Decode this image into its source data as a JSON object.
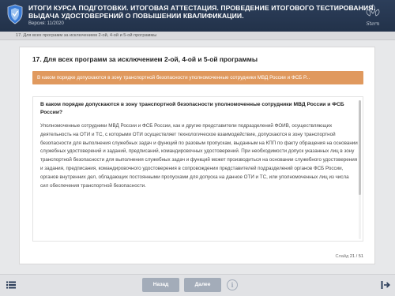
{
  "header": {
    "title_line1": "ИТОГИ КУРСА ПОДГОТОВКИ. ИТОГОВАЯ АТТЕСТАЦИЯ. ПРОВЕДЕНИЕ ИТОГОВОГО ТЕСТИРОВАНИЯ.",
    "title_line2": "ВЫДАЧА УДОСТОВЕРЕНИЙ О ПОВЫШЕНИИ КВАЛИФИКАЦИИ.",
    "version": "Версия: 11/2020",
    "brand_text": "Stern",
    "colors": {
      "header_bg": "#22324a",
      "accent": "#e0995e",
      "button": "#a3acb9"
    }
  },
  "breadcrumb": "17. Для всех программ за исключением 2-ой, 4-ой и 5-ой программы",
  "question": {
    "title": "17. Для всех программ за исключением 2-ой, 4-ой и 5-ой программы",
    "selected_bar": "В каком порядке допускаются в зону транспортной безопасности уполномоченные сотрудники МВД России и ФСБ Р...",
    "full_question": "В каком порядке допускаются в зону транспортной безопасности уполномоченные сотрудники МВД России и ФСБ России?",
    "answer": "Уполномоченные сотрудники МВД России и ФСБ России, как и другие представители подразделений ФОИВ, осуществляющих деятельность на ОТИ и ТС, с которыми ОТИ осуществляет технологическое взаимодействие, допускаются в зону транспортной безопасности для выполнения служебных задач и функций по разовым пропускам, выданным на КПП по факту обращения на основании служебных удостоверений и заданий, предписаний, командировочных удостоверений. При необходимости допуск указанных лиц в зону транспортной безопасности для выполнения служебных задач и функций может производиться на основании служебного удостоверения и задания, предписания, командировочного удостоверения в сопровождении представителей подразделений органов ФСБ России, органов внутренних дел, обладающих постоянными пропусками для допуска на данное ОТИ и ТС, или уполномоченных лиц из числа сил обеспечения транспортной безопасности."
  },
  "slide": {
    "label": "Слайд",
    "current": "21",
    "total": "51"
  },
  "footer": {
    "back_label": "Назад",
    "next_label": "Далее",
    "info_glyph": "i",
    "menu_icon": "menu-list-icon",
    "exit_icon": "exit-icon"
  }
}
